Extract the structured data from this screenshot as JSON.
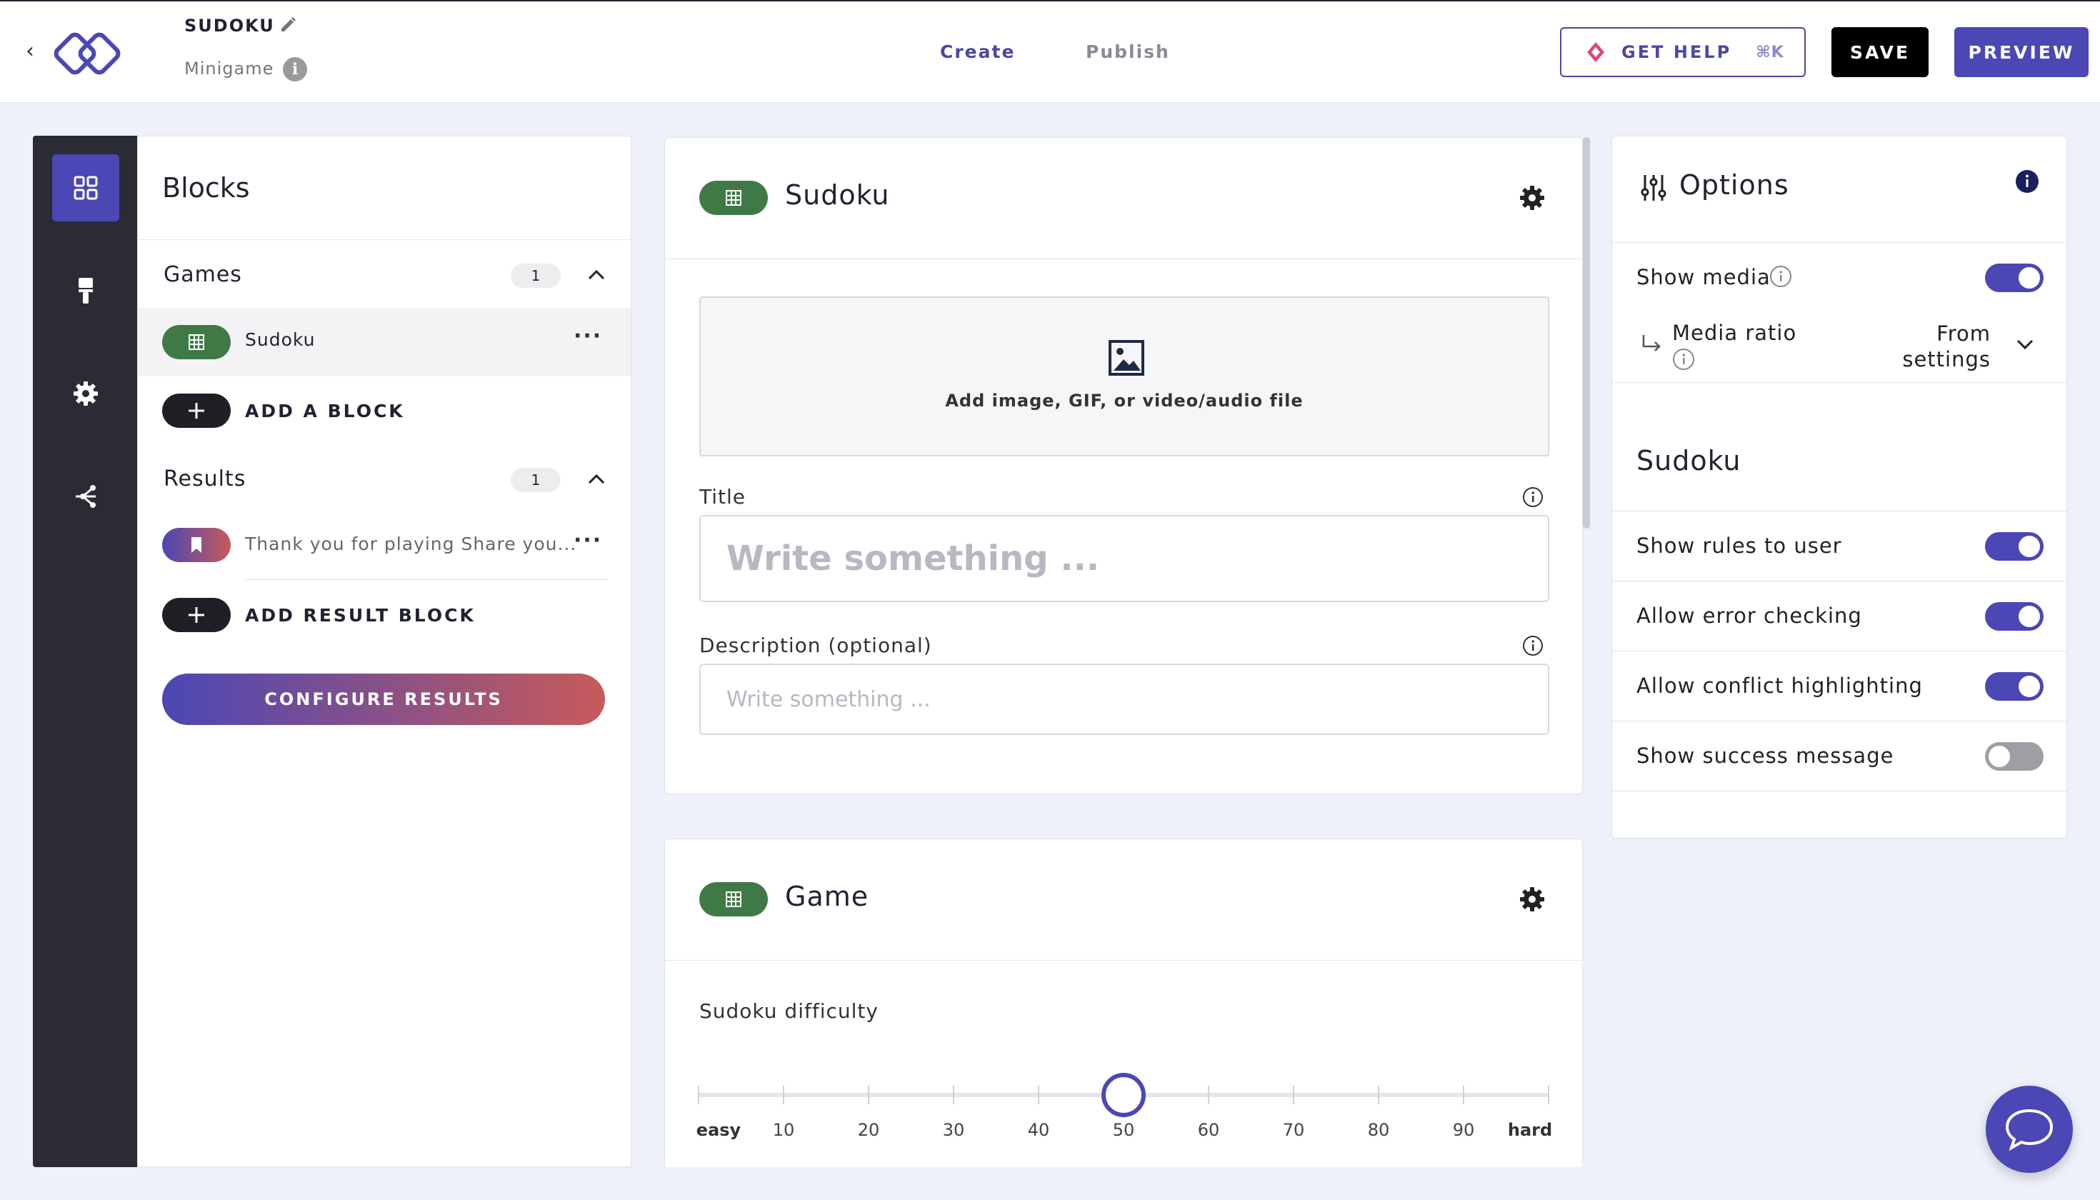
{
  "header": {
    "app_title": "SUDOKU",
    "app_subtitle": "Minigame",
    "tabs": [
      {
        "label": "Create"
      },
      {
        "label": "Publish"
      }
    ],
    "help_label": "GET HELP",
    "help_shortcut": "⌘K",
    "save_label": "SAVE",
    "preview_label": "PREVIEW"
  },
  "blocks": {
    "title": "Blocks",
    "games_label": "Games",
    "games_count": "1",
    "game_items": [
      {
        "label": "Sudoku"
      }
    ],
    "add_block_label": "ADD A BLOCK",
    "results_label": "Results",
    "results_count": "1",
    "result_items": [
      {
        "label": "Thank you for playing Share you..."
      }
    ],
    "add_result_label": "ADD RESULT BLOCK",
    "configure_label": "CONFIGURE RESULTS"
  },
  "editor": {
    "card1_title": "Sudoku",
    "media_label": "Add image, GIF, or video/audio file",
    "title_label": "Title",
    "title_placeholder": "Write something ...",
    "desc_label": "Description (optional)",
    "desc_placeholder": "Write something ...",
    "card2_title": "Game",
    "difficulty_label": "Sudoku difficulty",
    "slider": {
      "min_label": "easy",
      "max_label": "hard",
      "ticks": [
        "10",
        "20",
        "30",
        "40",
        "50",
        "60",
        "70",
        "80",
        "90"
      ],
      "value": 50
    }
  },
  "options": {
    "title": "Options",
    "show_media_label": "Show media",
    "show_media_on": true,
    "media_ratio_label": "Media ratio",
    "media_ratio_value_line1": "From",
    "media_ratio_value_line2": "settings",
    "section_title": "Sudoku",
    "rows": [
      {
        "label": "Show rules to user",
        "on": true
      },
      {
        "label": "Allow error checking",
        "on": true
      },
      {
        "label": "Allow conflict highlighting",
        "on": true
      },
      {
        "label": "Show success message",
        "on": false
      }
    ]
  },
  "colors": {
    "accent": "#4b47b5",
    "game_pill": "#3f7a46",
    "rail": "#2a2b35"
  }
}
